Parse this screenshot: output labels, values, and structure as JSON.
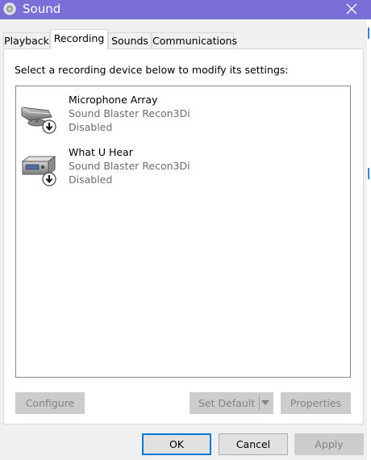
{
  "window": {
    "title": "Sound"
  },
  "tabs": [
    {
      "label": "Playback",
      "active": false
    },
    {
      "label": "Recording",
      "active": true
    },
    {
      "label": "Sounds",
      "active": false
    },
    {
      "label": "Communications",
      "active": false
    }
  ],
  "panel": {
    "instruction": "Select a recording device below to modify its settings:"
  },
  "devices": [
    {
      "name": "Microphone Array",
      "driver": "Sound Blaster Recon3Di",
      "status": "Disabled",
      "icon": "microphone-device-icon"
    },
    {
      "name": "What U Hear",
      "driver": "Sound Blaster Recon3Di",
      "status": "Disabled",
      "icon": "line-in-device-icon"
    }
  ],
  "panel_buttons": {
    "configure": "Configure",
    "set_default": "Set Default",
    "properties": "Properties"
  },
  "dialog_buttons": {
    "ok": "OK",
    "cancel": "Cancel",
    "apply": "Apply"
  },
  "colors": {
    "titlebar": "#7a6fd6",
    "focus_border": "#0078d7",
    "disabled_text": "#838383"
  }
}
